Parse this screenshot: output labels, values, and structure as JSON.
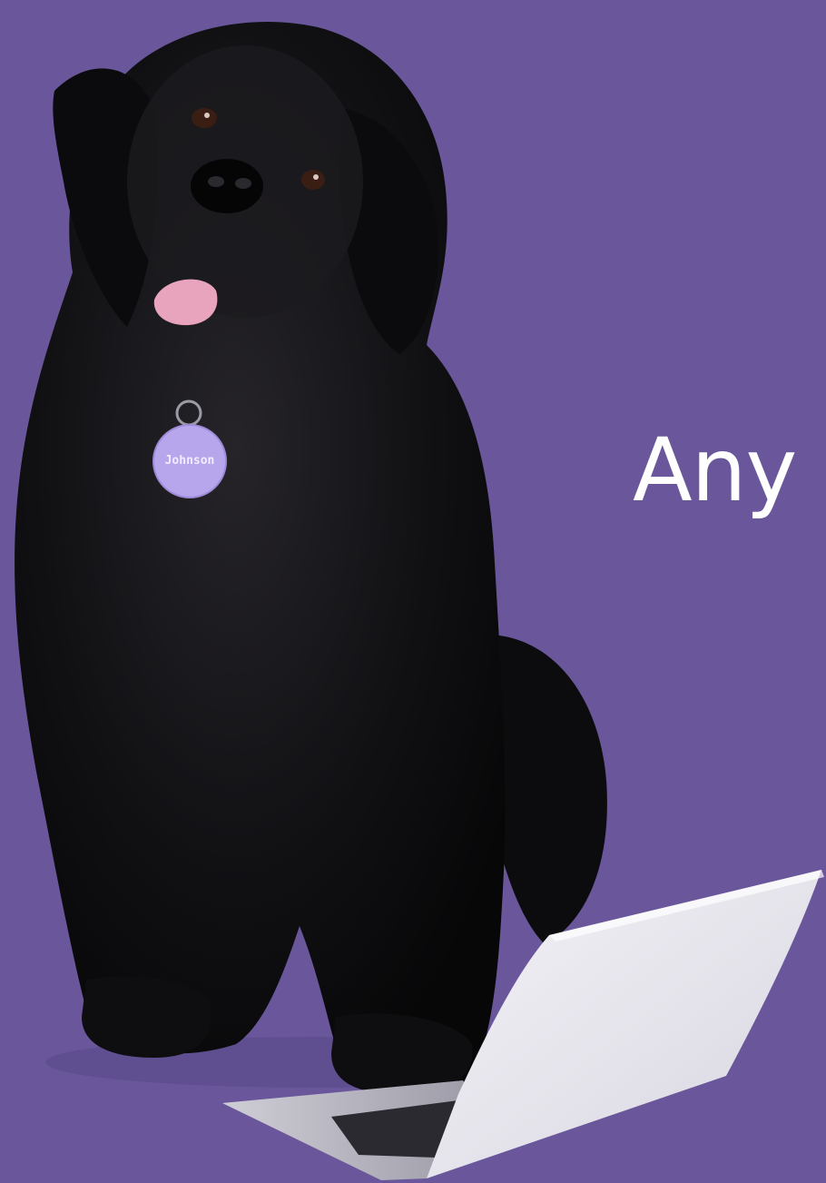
{
  "hero": {
    "headline": "Any d",
    "name_tag": "Johnson"
  },
  "colors": {
    "background": "#6a579b",
    "headline_text": "#ffffff",
    "dog_fur": "#0f0f12",
    "tag": "#b7a6ec",
    "laptop": "#e8e7ee"
  },
  "icons": {
    "pet_tag": "pet-tag-icon"
  }
}
